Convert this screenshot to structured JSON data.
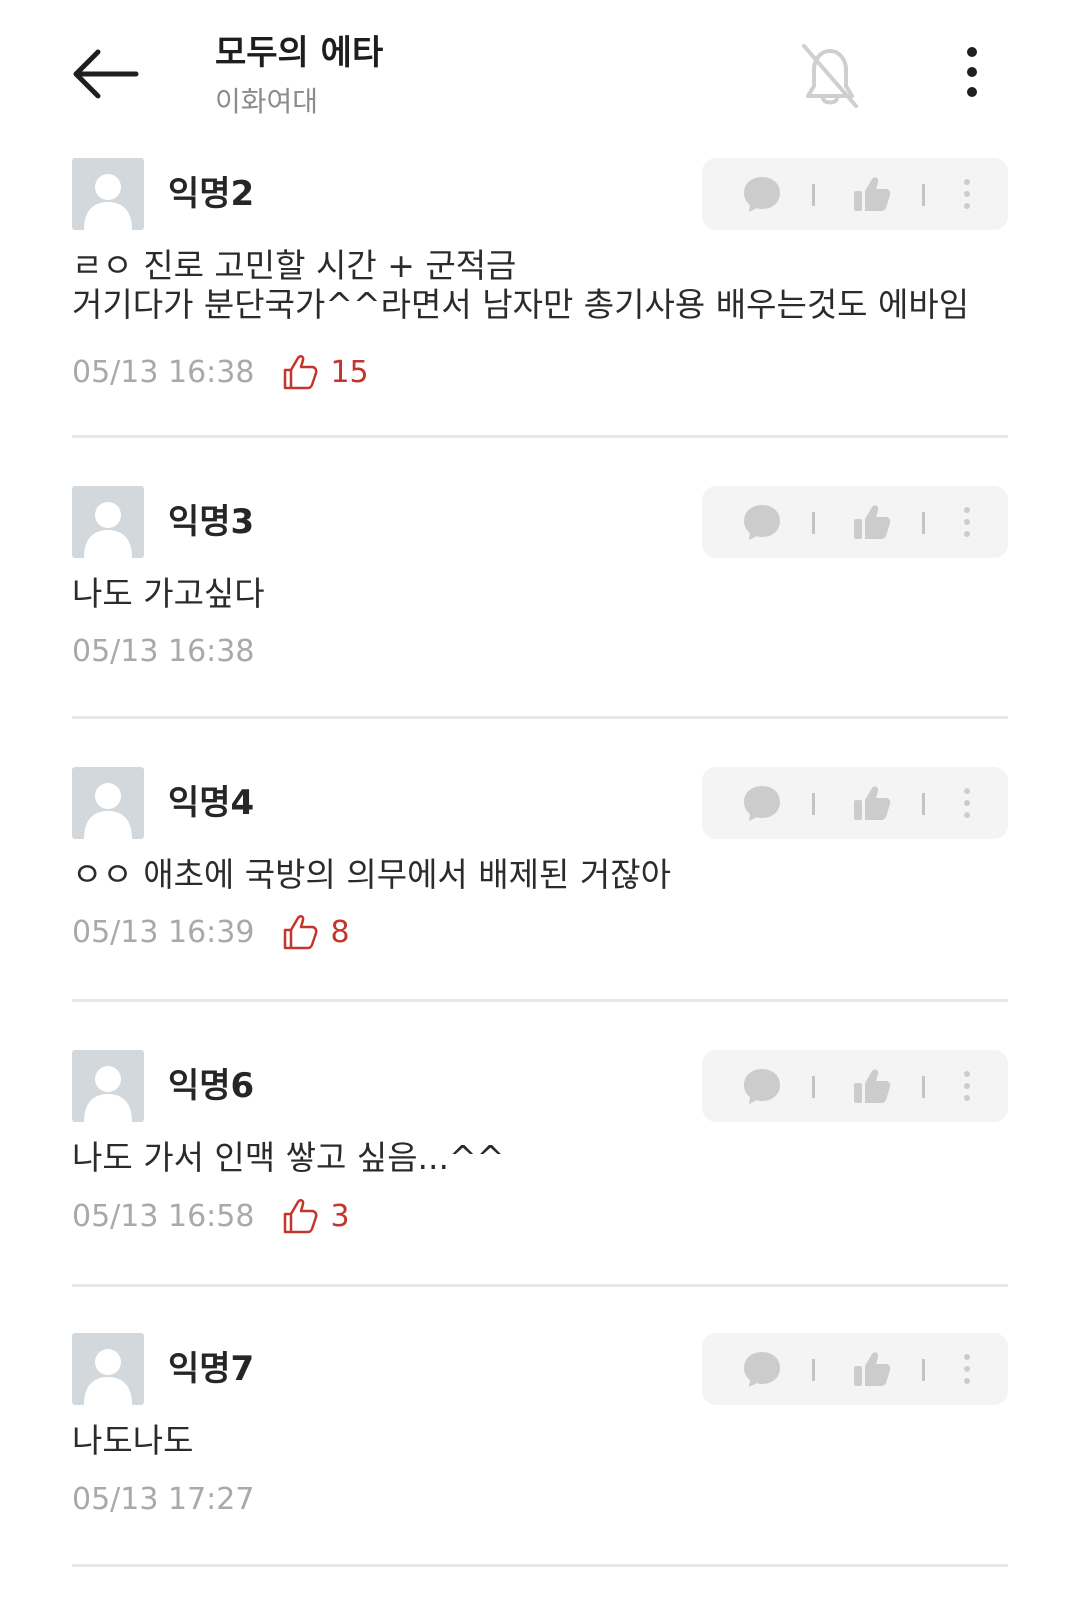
{
  "header": {
    "title": "모두의 에타",
    "subtitle": "이화여대"
  },
  "comments": [
    {
      "name": "익명2",
      "text": "ㄹㅇ 진로 고민할 시간 + 군적금\n거기다가 분단국가^^라면서 남자만 총기사용 배우는것도 에바임",
      "time": "05/13 16:38",
      "likes": "15"
    },
    {
      "name": "익명3",
      "text": "나도 가고싶다",
      "time": "05/13 16:38",
      "likes": ""
    },
    {
      "name": "익명4",
      "text": "ㅇㅇ 애초에 국방의 의무에서 배제된 거잖아",
      "time": "05/13 16:39",
      "likes": "8"
    },
    {
      "name": "익명6",
      "text": "나도 가서 인맥 쌓고 싶음...^^",
      "time": "05/13 16:58",
      "likes": "3"
    },
    {
      "name": "익명7",
      "text": "나도나도",
      "time": "05/13 17:27",
      "likes": ""
    }
  ],
  "colors": {
    "like_red": "#c2362c",
    "meta_gray": "#a9a9a9",
    "action_bg": "#f4f4f4"
  },
  "icons": [
    "back-arrow-icon",
    "bell-off-icon",
    "more-vertical-icon",
    "speech-bubble-icon",
    "thumbs-up-icon",
    "more-dots-icon",
    "avatar-placeholder-icon"
  ]
}
